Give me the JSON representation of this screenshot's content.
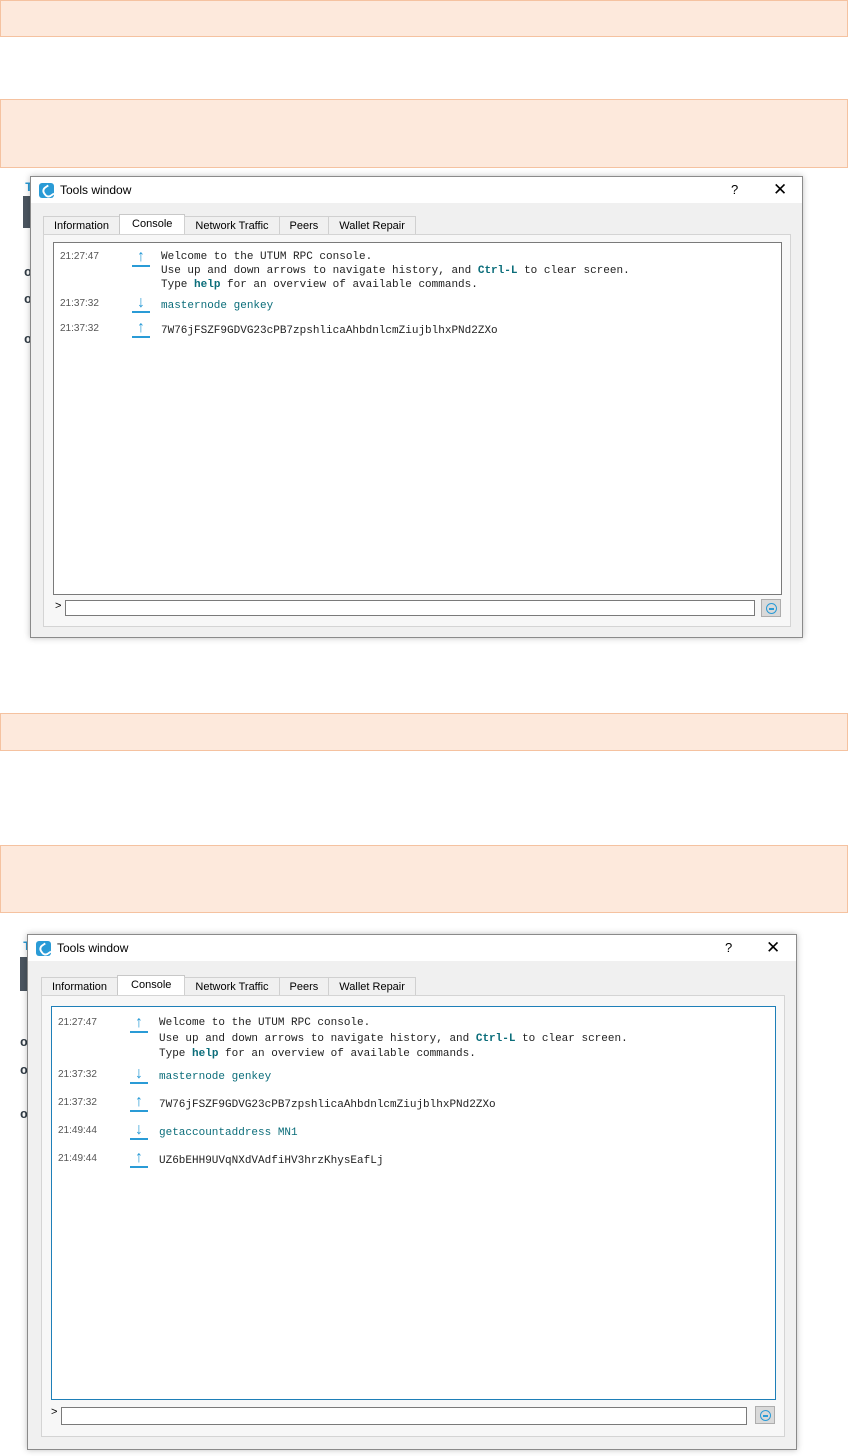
{
  "window_title": "Tools window",
  "help_label": "?",
  "close_label": "✕",
  "tabs": [
    "Information",
    "Console",
    "Network Traffic",
    "Peers",
    "Wallet Repair"
  ],
  "prompt_symbol": ">",
  "welcome": {
    "line1": "Welcome to the UTUM RPC console.",
    "line2_pre": "Use up and down arrows to navigate history, and ",
    "line2_kw": "Ctrl-L",
    "line2_post": " to clear screen.",
    "line3_pre": "Type ",
    "line3_kw": "help",
    "line3_post": " for an overview of available commands."
  },
  "first_console": {
    "messages": [
      {
        "time": "21:27:47",
        "dir": "reply"
      },
      {
        "time": "21:37:32",
        "dir": "request",
        "text": "masternode genkey"
      },
      {
        "time": "21:37:32",
        "dir": "reply",
        "text": "7W76jFSZF9GDVG23cPB7zpshlicaAhbdnlcmZiujblhxPNd2ZXo"
      }
    ]
  },
  "second_console": {
    "messages": [
      {
        "time": "21:27:47",
        "dir": "reply"
      },
      {
        "time": "21:37:32",
        "dir": "request",
        "text": "masternode genkey"
      },
      {
        "time": "21:37:32",
        "dir": "reply",
        "text": "7W76jFSZF9GDVG23cPB7zpshlicaAhbdnlcmZiujblhxPNd2ZXo"
      },
      {
        "time": "21:49:44",
        "dir": "request",
        "text": "getaccountaddress MN1"
      },
      {
        "time": "21:49:44",
        "dir": "reply",
        "text": "UZ6bEHH9UVqNXdVAdfiHV3hrzKhysEafLj"
      }
    ]
  },
  "background_fragments": [
    "T",
    "T",
    "o",
    "o",
    "o",
    "o",
    "o",
    "o"
  ],
  "colors": {
    "accent": "#2a9bd6",
    "command_text": "#0b6d7a",
    "note_bar_fill": "#fde9dc",
    "note_bar_border": "#f5c2a0",
    "active_console_border": "#1e7fb8"
  }
}
